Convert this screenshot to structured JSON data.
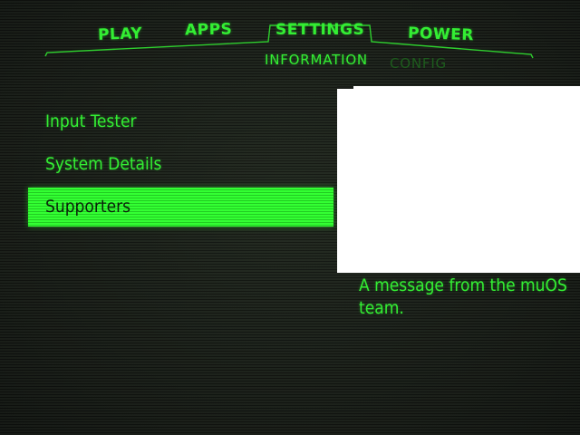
{
  "theme": {
    "accent": "#33ee33",
    "accent_dim": "#1d5c1d",
    "background": "#1a1e19",
    "selected_text": "#0b200b",
    "preview_background": "#ffffff"
  },
  "tabs": [
    {
      "label": "PLAY",
      "active": false
    },
    {
      "label": "APPS",
      "active": false
    },
    {
      "label": "SETTINGS",
      "active": true
    },
    {
      "label": "POWER",
      "active": false
    }
  ],
  "subtabs": [
    {
      "label": "INFORMATION",
      "active": true
    },
    {
      "label": "CONFIG",
      "active": false
    }
  ],
  "menu": {
    "items": [
      {
        "label": "Input Tester",
        "selected": false
      },
      {
        "label": "System Details",
        "selected": false
      },
      {
        "label": "Supporters",
        "selected": true
      }
    ]
  },
  "description": "A message from the muOS team."
}
